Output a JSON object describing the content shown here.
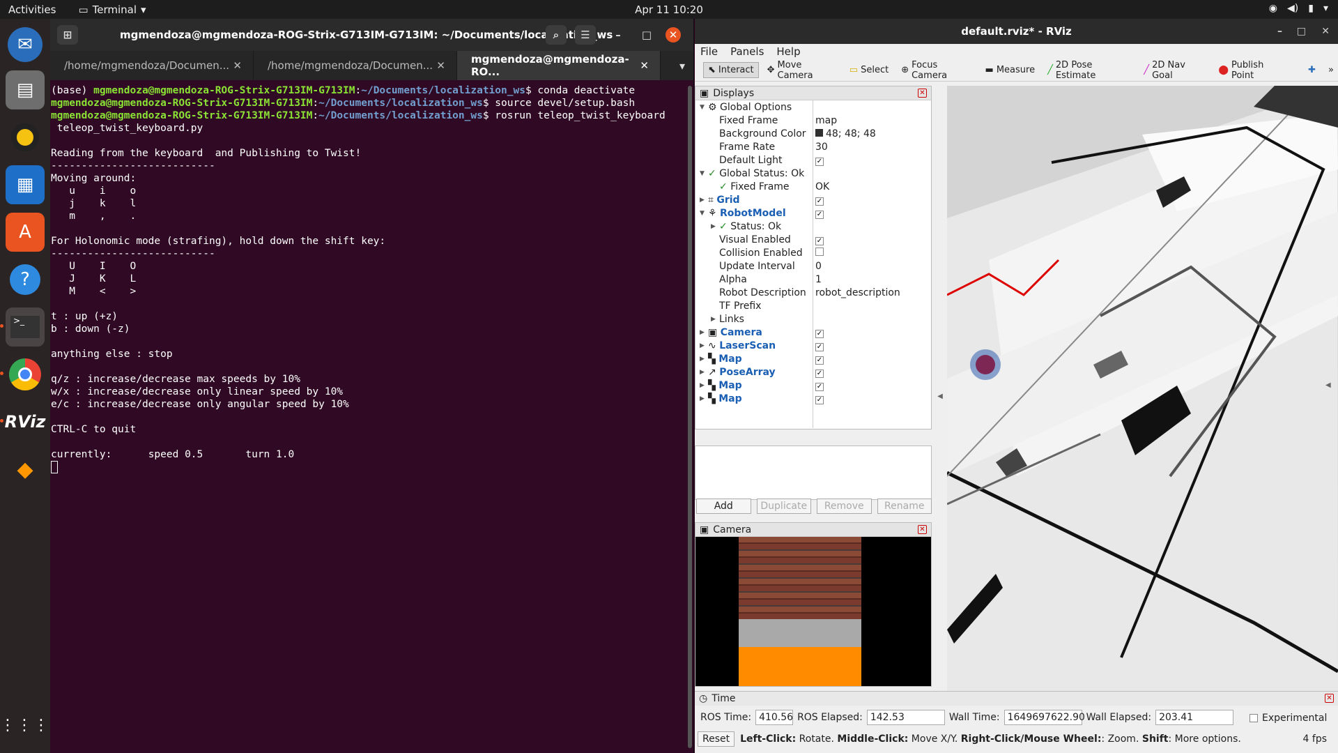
{
  "topbar": {
    "activities": "Activities",
    "app": "Terminal",
    "clock": "Apr 11  10:20"
  },
  "dock": {
    "items": [
      "thunderbird-icon",
      "files-icon",
      "rhythmbox-icon",
      "writer-icon",
      "software-icon",
      "help-icon",
      "terminal-icon",
      "chrome-icon",
      "rviz-icon",
      "sublime-icon"
    ],
    "apps_label": "Show Applications"
  },
  "terminal": {
    "title": "mgmendoza@mgmendoza-ROG-Strix-G713IM-G713IM: ~/Documents/localization_ws",
    "tabs": [
      "/home/mgmendoza/Documen...",
      "/home/mgmendoza/Documen...",
      "mgmendoza@mgmendoza-RO..."
    ],
    "prompt_user": "mgmendoza@mgmendoza-ROG-Strix-G713IM-G713IM",
    "prompt_path": "~/Documents/localization_ws",
    "cmd1_prefix": "(base) ",
    "cmd1": "conda deactivate",
    "cmd2": "source devel/setup.bash",
    "cmd3": "rosrun teleop_twist_keyboard",
    "cmd3_cont": " teleop_twist_keyboard.py",
    "output": "\nReading from the keyboard  and Publishing to Twist!\n---------------------------\nMoving around:\n   u    i    o\n   j    k    l\n   m    ,    .\n\nFor Holonomic mode (strafing), hold down the shift key:\n---------------------------\n   U    I    O\n   J    K    L\n   M    <    >\n\nt : up (+z)\nb : down (-z)\n\nanything else : stop\n\nq/z : increase/decrease max speeds by 10%\nw/x : increase/decrease only linear speed by 10%\ne/c : increase/decrease only angular speed by 10%\n\nCTRL-C to quit\n\ncurrently:\tspeed 0.5\tturn 1.0 "
  },
  "rviz": {
    "title": "default.rviz* - RViz",
    "menu": [
      "File",
      "Panels",
      "Help"
    ],
    "tools": [
      "Interact",
      "Move Camera",
      "Select",
      "Focus Camera",
      "Measure",
      "2D Pose Estimate",
      "2D Nav Goal",
      "Publish Point"
    ],
    "displays_title": "Displays",
    "rows": [
      {
        "k": "Global Options",
        "v": "",
        "lvl": 0
      },
      {
        "k": "Fixed Frame",
        "v": "map",
        "lvl": 1
      },
      {
        "k": "Background Color",
        "v": "48; 48; 48",
        "lvl": 1
      },
      {
        "k": "Frame Rate",
        "v": "30",
        "lvl": 1
      },
      {
        "k": "Default Light",
        "v": "✓",
        "lvl": 1
      },
      {
        "k": "Global Status: Ok",
        "v": "",
        "lvl": 0
      },
      {
        "k": "Fixed Frame",
        "v": "OK",
        "lvl": 1
      },
      {
        "k": "Grid",
        "v": "✓",
        "lvl": 0
      },
      {
        "k": "RobotModel",
        "v": "✓",
        "lvl": 0
      },
      {
        "k": "Status: Ok",
        "v": "",
        "lvl": 1
      },
      {
        "k": "Visual Enabled",
        "v": "✓",
        "lvl": 1
      },
      {
        "k": "Collision Enabled",
        "v": "",
        "lvl": 1
      },
      {
        "k": "Update Interval",
        "v": "0",
        "lvl": 1
      },
      {
        "k": "Alpha",
        "v": "1",
        "lvl": 1
      },
      {
        "k": "Robot Description",
        "v": "robot_description",
        "lvl": 1
      },
      {
        "k": "TF Prefix",
        "v": "",
        "lvl": 1
      },
      {
        "k": "Links",
        "v": "",
        "lvl": 1
      },
      {
        "k": "Camera",
        "v": "✓",
        "lvl": 0
      },
      {
        "k": "LaserScan",
        "v": "✓",
        "lvl": 0
      },
      {
        "k": "Map",
        "v": "✓",
        "lvl": 0
      },
      {
        "k": "PoseArray",
        "v": "✓",
        "lvl": 0
      },
      {
        "k": "Map",
        "v": "✓",
        "lvl": 0
      },
      {
        "k": "Map",
        "v": "✓",
        "lvl": 0
      }
    ],
    "buttons": [
      "Add",
      "Duplicate",
      "Remove",
      "Rename"
    ],
    "camera_title": "Camera",
    "time": {
      "title": "Time",
      "ros_time_label": "ROS Time:",
      "ros_time": "410.56",
      "ros_elapsed_label": "ROS Elapsed:",
      "ros_elapsed": "142.53",
      "wall_time_label": "Wall Time:",
      "wall_time": "1649697622.90",
      "wall_elapsed_label": "Wall Elapsed:",
      "wall_elapsed": "203.41",
      "experimental": "Experimental",
      "reset": "Reset",
      "fps": "4 fps",
      "help_1": "Left-Click:",
      "help_1v": " Rotate. ",
      "help_2": "Middle-Click:",
      "help_2v": " Move X/Y. ",
      "help_3": "Right-Click/Mouse Wheel:",
      "help_3v": ": Zoom. ",
      "help_4": "Shift",
      "help_4v": ": More options."
    }
  }
}
